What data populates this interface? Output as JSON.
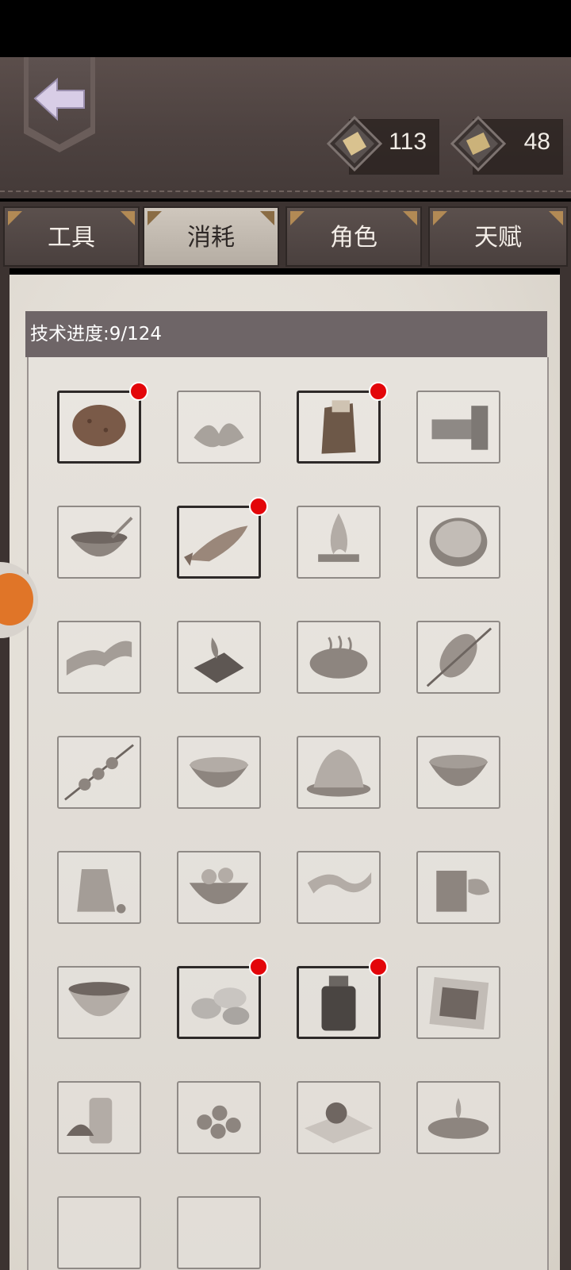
{
  "header": {
    "back_icon": "back-arrow-icon",
    "currencies": [
      {
        "icon": "scroll-gem-icon",
        "value": "113"
      },
      {
        "icon": "parchment-gem-icon",
        "value": "48"
      }
    ]
  },
  "tabs": [
    {
      "label": "工具",
      "active": false
    },
    {
      "label": "消耗",
      "active": true
    },
    {
      "label": "角色",
      "active": false
    },
    {
      "label": "天赋",
      "active": false
    }
  ],
  "progress": {
    "label": "技术进度:9/124"
  },
  "items": [
    {
      "icon": "potato-icon",
      "unlocked": true,
      "badge": true
    },
    {
      "icon": "herb-leaf-icon",
      "unlocked": false,
      "badge": false
    },
    {
      "icon": "flour-sack-icon",
      "unlocked": true,
      "badge": true
    },
    {
      "icon": "wood-logs-icon",
      "unlocked": false,
      "badge": false
    },
    {
      "icon": "soup-bowl-icon",
      "unlocked": false,
      "badge": false
    },
    {
      "icon": "dried-fish-icon",
      "unlocked": true,
      "badge": true
    },
    {
      "icon": "campfire-icon",
      "unlocked": false,
      "badge": false
    },
    {
      "icon": "noodle-bowl-icon",
      "unlocked": false,
      "badge": false
    },
    {
      "icon": "bacon-icon",
      "unlocked": false,
      "badge": false
    },
    {
      "icon": "grilled-meat-icon",
      "unlocked": false,
      "badge": false
    },
    {
      "icon": "steak-icon",
      "unlocked": false,
      "badge": false
    },
    {
      "icon": "roast-skewer-icon",
      "unlocked": false,
      "badge": false
    },
    {
      "icon": "kebab-icon",
      "unlocked": false,
      "badge": false
    },
    {
      "icon": "stew-bowl-icon",
      "unlocked": false,
      "badge": false
    },
    {
      "icon": "fried-food-icon",
      "unlocked": false,
      "badge": false
    },
    {
      "icon": "porridge-bowl-icon",
      "unlocked": false,
      "badge": false
    },
    {
      "icon": "spice-bag-icon",
      "unlocked": false,
      "badge": false
    },
    {
      "icon": "dumpling-bowl-icon",
      "unlocked": false,
      "badge": false
    },
    {
      "icon": "ribbon-pasta-icon",
      "unlocked": false,
      "badge": false
    },
    {
      "icon": "tea-jar-icon",
      "unlocked": false,
      "badge": false
    },
    {
      "icon": "broth-bowl-icon",
      "unlocked": false,
      "badge": false
    },
    {
      "icon": "salt-cakes-icon",
      "unlocked": true,
      "badge": true
    },
    {
      "icon": "herb-jar-icon",
      "unlocked": true,
      "badge": true
    },
    {
      "icon": "seaweed-sheet-icon",
      "unlocked": false,
      "badge": false
    },
    {
      "icon": "sauce-bottle-icon",
      "unlocked": false,
      "badge": false
    },
    {
      "icon": "berries-icon",
      "unlocked": false,
      "badge": false
    },
    {
      "icon": "egg-on-cloth-icon",
      "unlocked": false,
      "badge": false
    },
    {
      "icon": "oil-splash-icon",
      "unlocked": false,
      "badge": false
    }
  ]
}
